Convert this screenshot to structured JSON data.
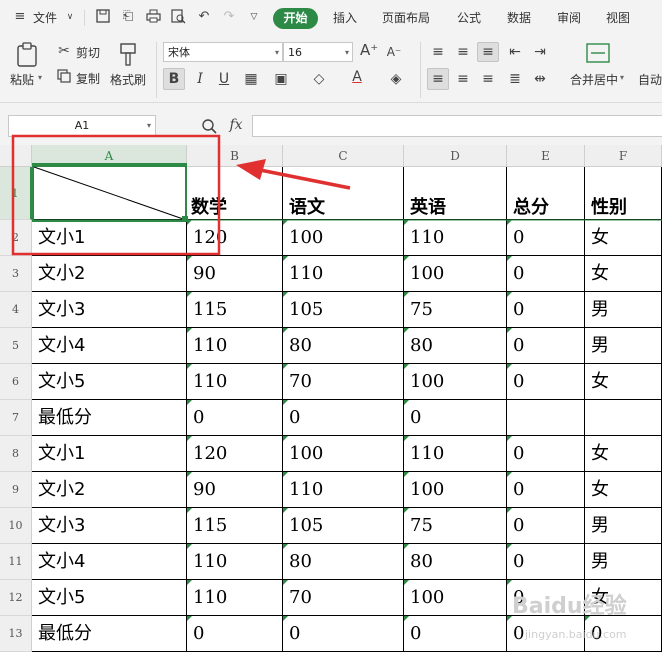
{
  "menubar": {
    "file_menu": "文件",
    "tabs": [
      {
        "label": "开始",
        "active": true
      },
      {
        "label": "插入"
      },
      {
        "label": "页面布局"
      },
      {
        "label": "公式"
      },
      {
        "label": "数据"
      },
      {
        "label": "审阅"
      },
      {
        "label": "视图"
      }
    ]
  },
  "ribbon": {
    "paste": "粘贴",
    "cut": "剪切",
    "copy": "复制",
    "format_painter": "格式刷",
    "font_name": "宋体",
    "font_size": "16",
    "merge_center": "合并居中",
    "auto_wrap": "自动"
  },
  "formula_bar": {
    "name_box": "A1",
    "fx": "fx",
    "formula": ""
  },
  "grid": {
    "columns": [
      "A",
      "B",
      "C",
      "D",
      "E",
      "F"
    ],
    "row_numbers": [
      "1",
      "2",
      "3",
      "4",
      "5",
      "6",
      "7",
      "8",
      "9",
      "10",
      "11",
      "12",
      "13"
    ],
    "header_row": [
      "",
      "数学",
      "语文",
      "英语",
      "总分",
      "性别"
    ],
    "rows": [
      [
        "文小1",
        "120",
        "100",
        "110",
        "0",
        "女"
      ],
      [
        "文小2",
        "90",
        "110",
        "100",
        "0",
        "女"
      ],
      [
        "文小3",
        "115",
        "105",
        "75",
        "0",
        "男"
      ],
      [
        "文小4",
        "110",
        "80",
        "80",
        "0",
        "男"
      ],
      [
        "文小5",
        "110",
        "70",
        "100",
        "0",
        "女"
      ],
      [
        "最低分",
        "0",
        "0",
        "0",
        "",
        ""
      ],
      [
        "文小1",
        "120",
        "100",
        "110",
        "0",
        "女"
      ],
      [
        "文小2",
        "90",
        "110",
        "100",
        "0",
        "女"
      ],
      [
        "文小3",
        "115",
        "105",
        "75",
        "0",
        "男"
      ],
      [
        "文小4",
        "110",
        "80",
        "80",
        "0",
        "男"
      ],
      [
        "文小5",
        "110",
        "70",
        "100",
        "0",
        "女"
      ],
      [
        "最低分",
        "0",
        "0",
        "0",
        "0",
        "0"
      ]
    ]
  },
  "colors": {
    "accent_green": "#2d8a46",
    "annotation_red": "#e03030"
  },
  "watermark": {
    "text": "Baidu经验",
    "url": "jingyan.baidu.com"
  }
}
